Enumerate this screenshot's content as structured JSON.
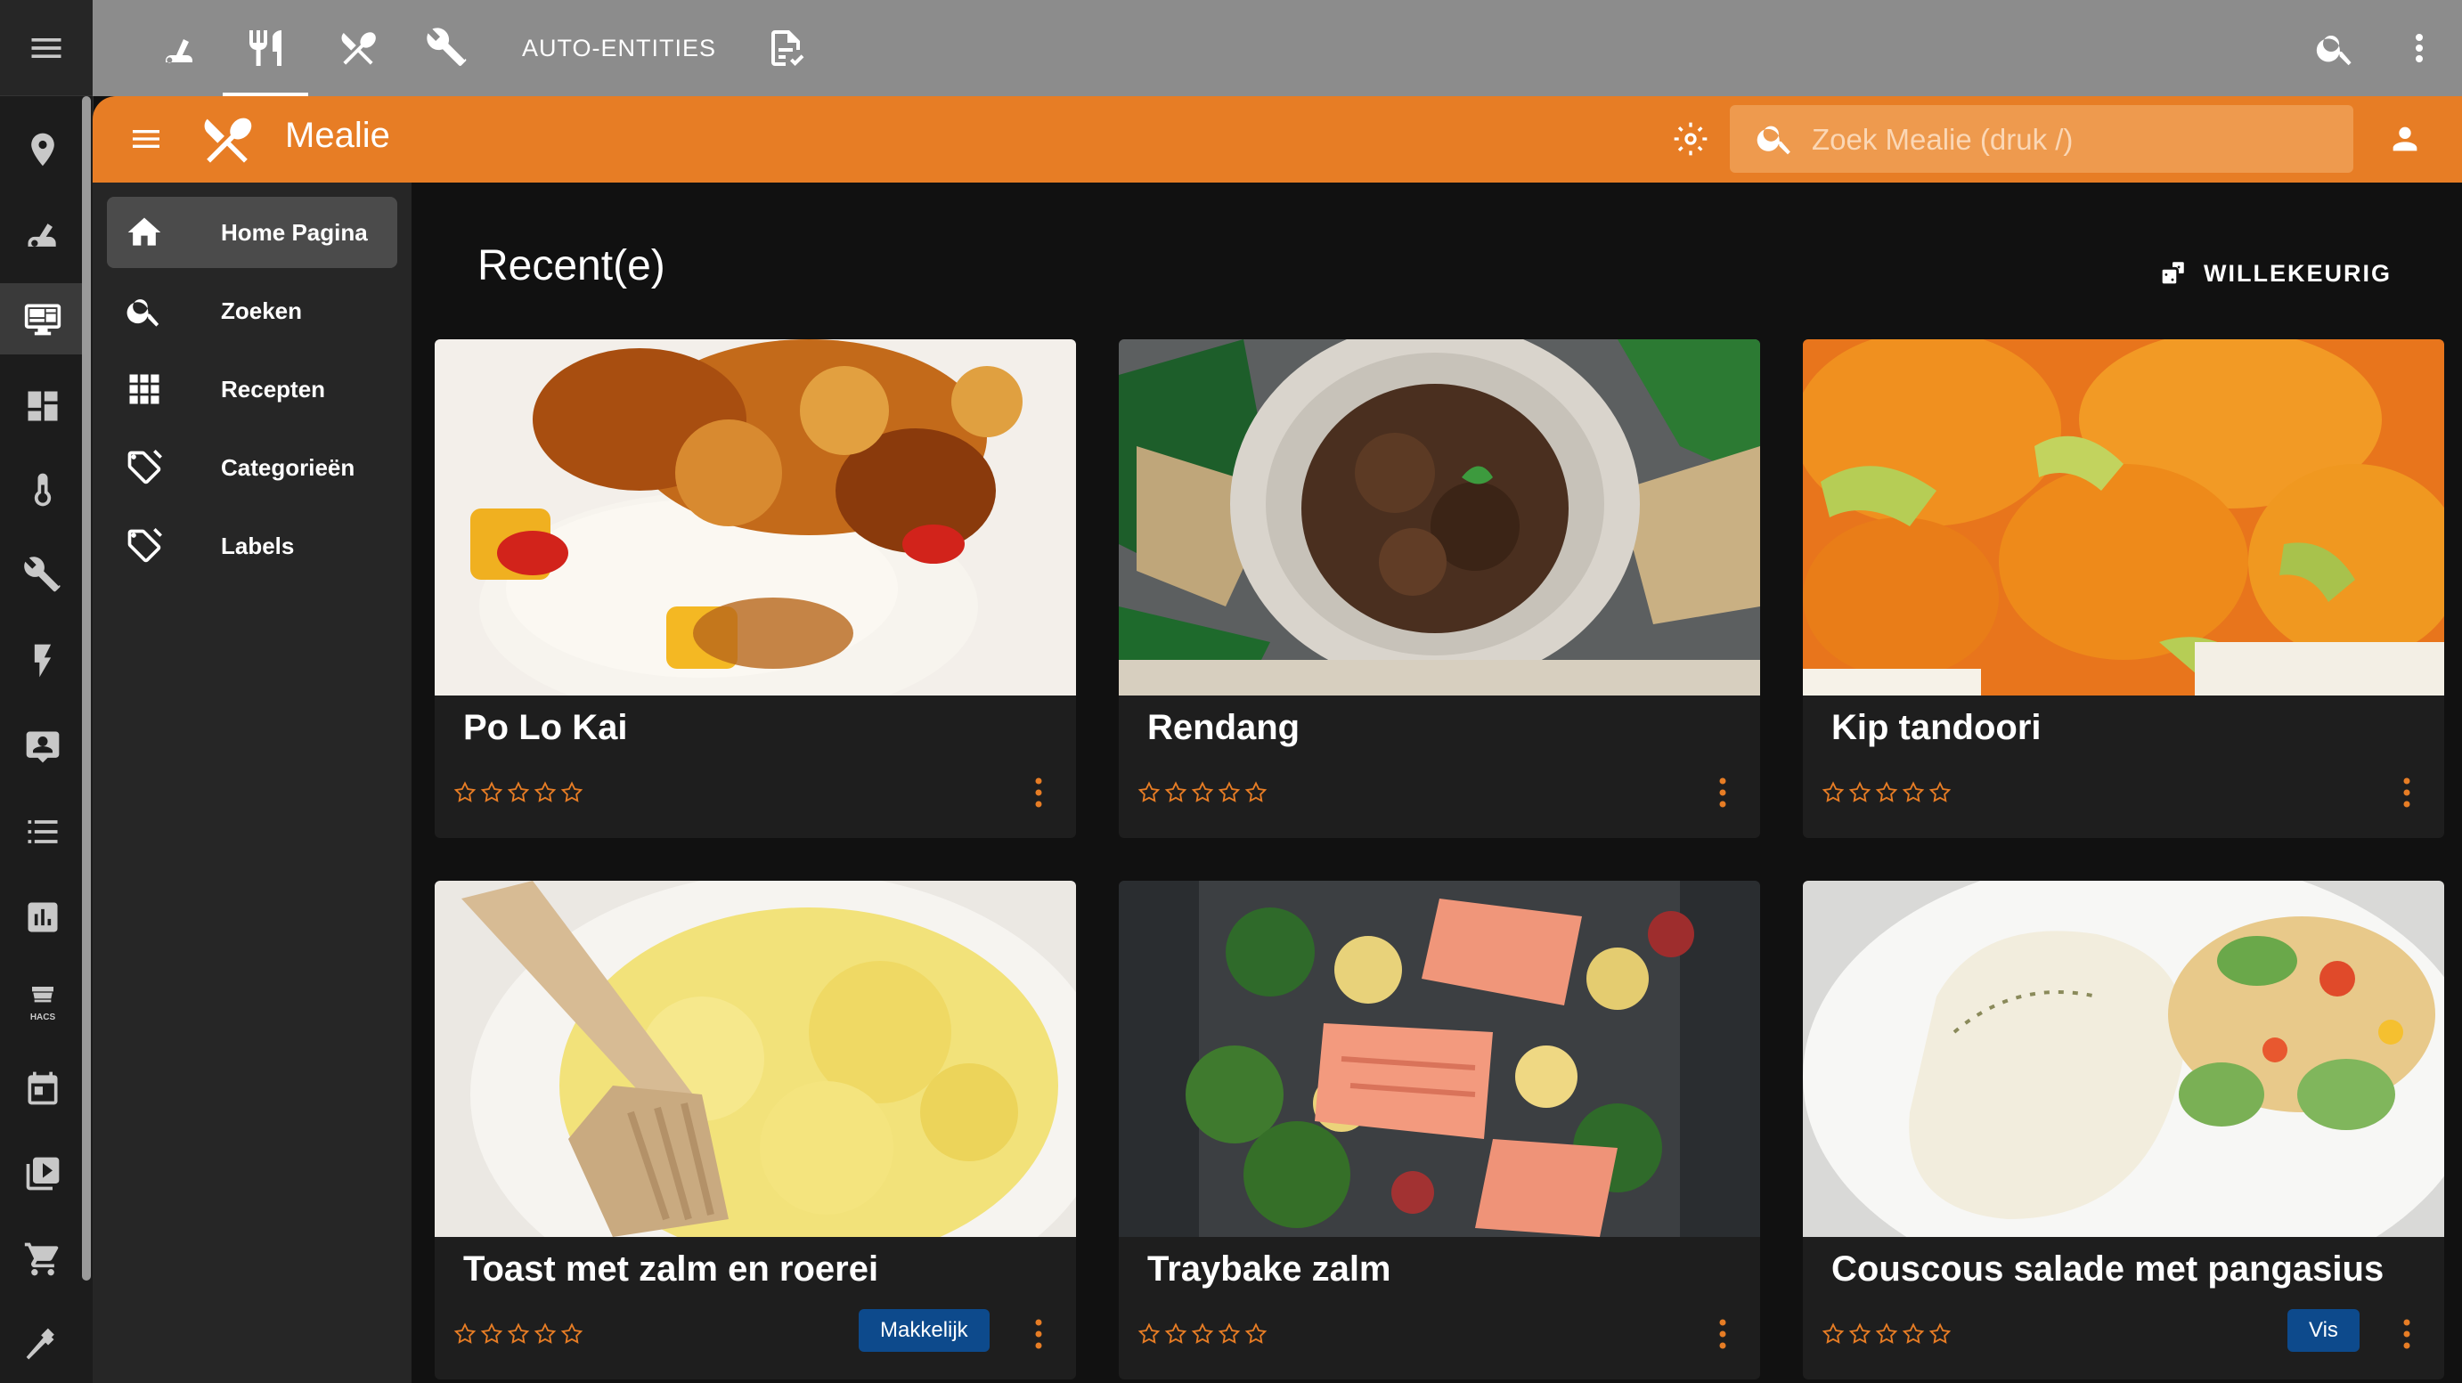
{
  "colors": {
    "accent": "#e77d25",
    "tag_bg": "#0d4a8c",
    "star": "#e77d25"
  },
  "ha_rail": {
    "icons": [
      "menu-icon",
      "map-marker-icon",
      "vacuum-icon",
      "monitor-dashboard-icon",
      "view-dashboard-icon",
      "thermometer-icon",
      "tools-icon",
      "flash-icon",
      "contact-card-icon",
      "list-icon",
      "chart-bar-icon",
      "hacs-store-icon",
      "calendar-icon",
      "media-icon",
      "cart-icon",
      "hammer-icon"
    ],
    "hacs_label": "HACS"
  },
  "ha_topbar": {
    "tabs": [
      {
        "icon": "robot-vacuum-icon"
      },
      {
        "icon": "silverware-fork-knife-icon",
        "active": true
      },
      {
        "icon": "silverware-icon"
      },
      {
        "icon": "tools-icon"
      },
      {
        "label": "AUTO-ENTITIES"
      },
      {
        "icon": "file-document-check-icon"
      }
    ]
  },
  "mealie": {
    "brand": "Mealie",
    "search_placeholder": "Zoek Mealie (druk /)",
    "nav": [
      {
        "label": "Home Pagina",
        "icon": "home-icon",
        "active": true
      },
      {
        "label": "Zoeken",
        "icon": "search-icon"
      },
      {
        "label": "Recepten",
        "icon": "grid-icon"
      },
      {
        "label": "Categorieën",
        "icon": "tags-icon"
      },
      {
        "label": "Labels",
        "icon": "tags-icon"
      }
    ],
    "section_title": "Recent(e)",
    "random_button": "WILLEKEURIG",
    "recipes": [
      {
        "title": "Po Lo Kai",
        "rating": 0,
        "tag": ""
      },
      {
        "title": "Rendang",
        "rating": 0,
        "tag": ""
      },
      {
        "title": "Kip tandoori",
        "rating": 0,
        "tag": ""
      },
      {
        "title": "Toast met zalm en roerei",
        "rating": 0,
        "tag": "Makkelijk"
      },
      {
        "title": "Traybake zalm",
        "rating": 0,
        "tag": ""
      },
      {
        "title": "Couscous salade met pangasius",
        "rating": 0,
        "tag": "Vis"
      }
    ]
  }
}
